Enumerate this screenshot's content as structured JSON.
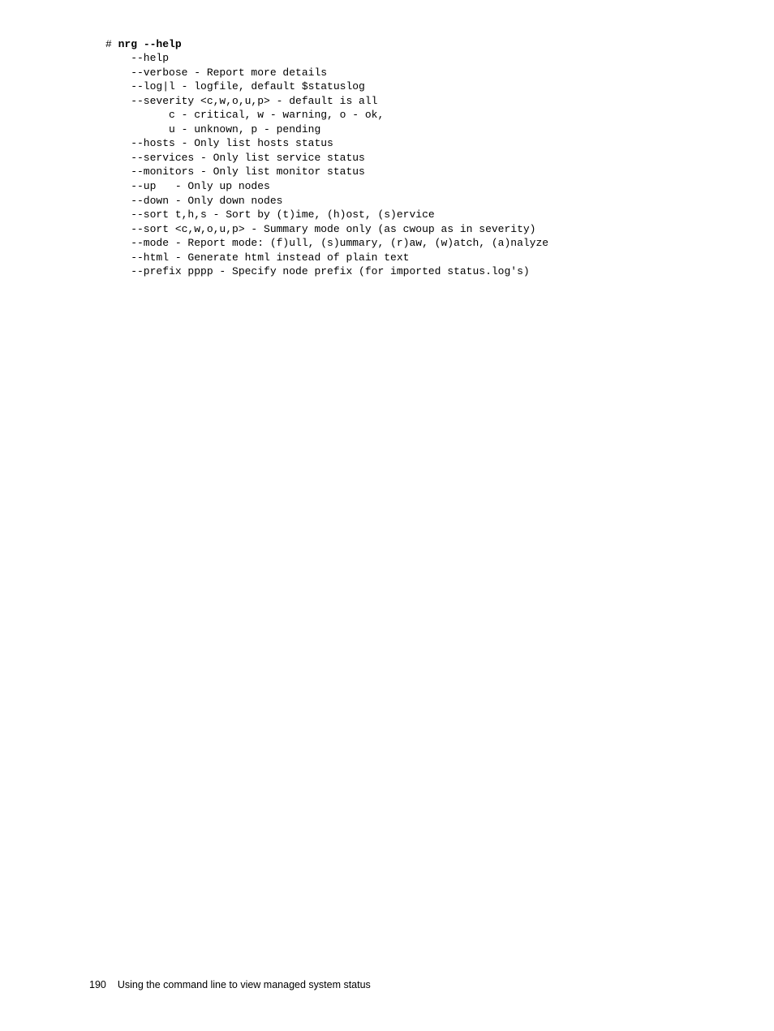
{
  "command": {
    "prompt": "# ",
    "cmd": "nrg --help"
  },
  "lines": {
    "l0": "    --help",
    "l1": "    --verbose - Report more details",
    "l2": "    --log|l - logfile, default $statuslog",
    "l3": "    --severity <c,w,o,u,p> - default is all",
    "l4": "          c - critical, w - warning, o - ok,",
    "l5": "          u - unknown, p - pending",
    "l6": "    --hosts - Only list hosts status",
    "l7": "    --services - Only list service status",
    "l8": "    --monitors - Only list monitor status",
    "l9": "    --up   - Only up nodes",
    "l10": "    --down - Only down nodes",
    "l11": "    --sort t,h,s - Sort by (t)ime, (h)ost, (s)ervice",
    "l12": "    --sort <c,w,o,u,p> - Summary mode only (as cwoup as in severity)",
    "l13": "    --mode - Report mode: (f)ull, (s)ummary, (r)aw, (w)atch, (a)nalyze",
    "l14": "    --html - Generate html instead of plain text",
    "l15": "    --prefix pppp - Specify node prefix (for imported status.log's)"
  },
  "footer": {
    "page_number": "190",
    "title": "Using the command line to view managed system status"
  }
}
